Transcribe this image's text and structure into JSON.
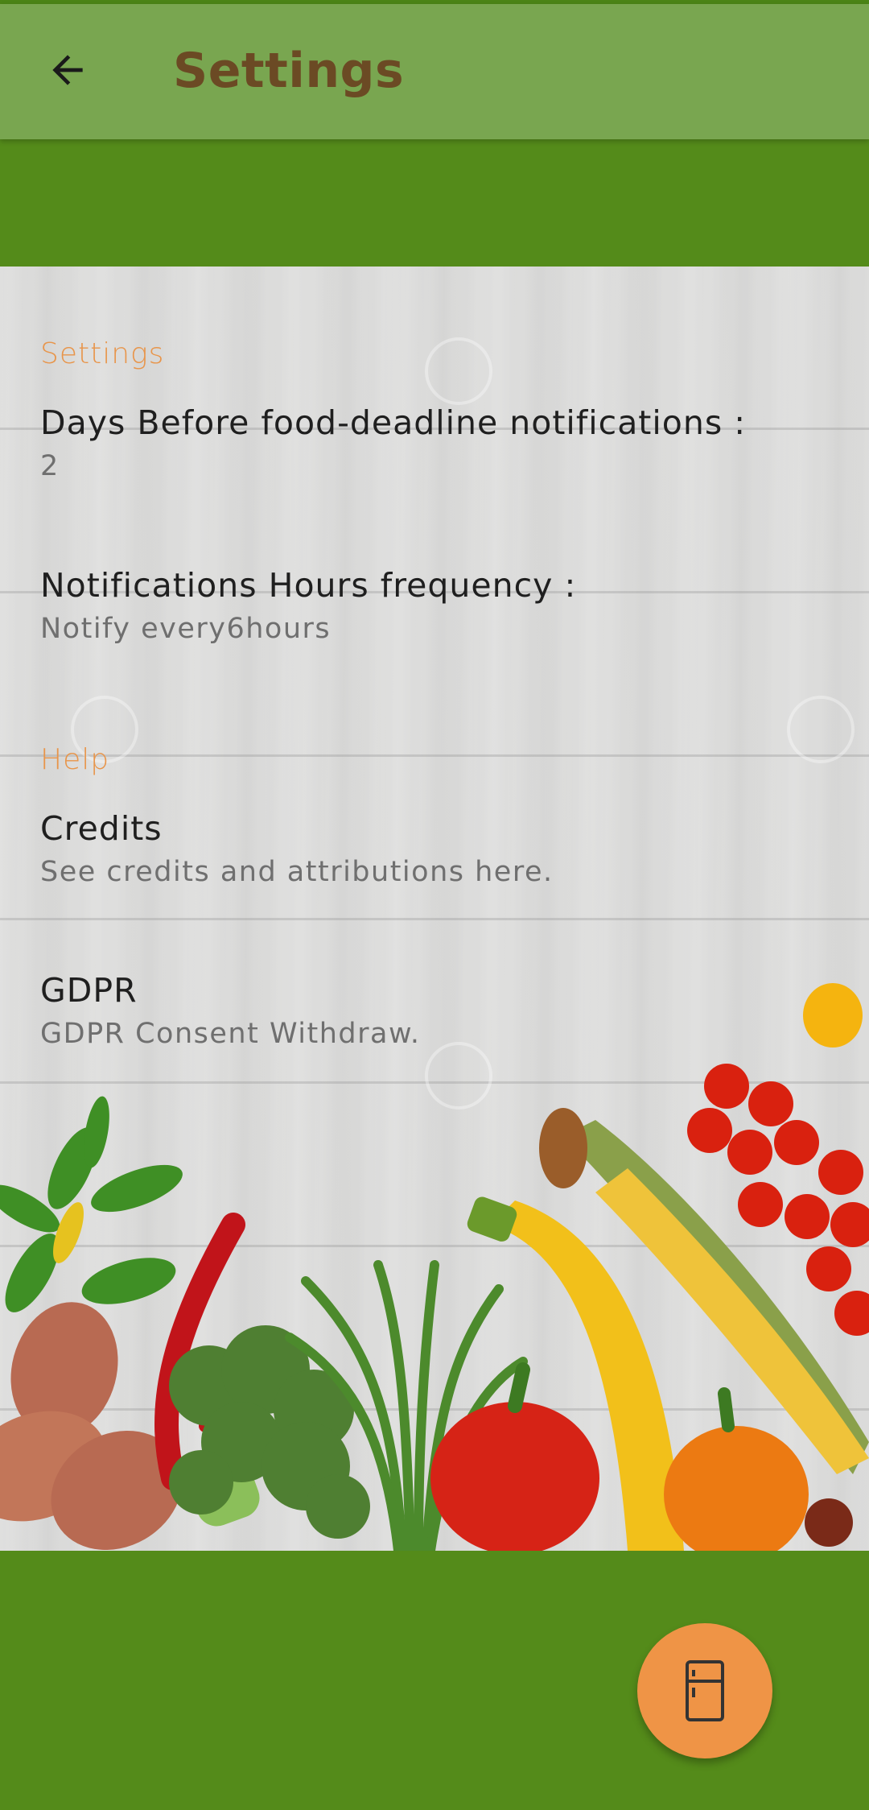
{
  "app_bar": {
    "title": "Settings",
    "back_icon": "arrow-left-icon"
  },
  "sections": [
    {
      "header": "Settings",
      "items": [
        {
          "title": "Days Before food-deadline notifications :",
          "summary": "2"
        },
        {
          "title": "Notifications Hours frequency :",
          "summary": "Notify every6hours"
        }
      ]
    },
    {
      "header": "Help",
      "items": [
        {
          "title": "Credits",
          "summary": "See credits and attributions here."
        },
        {
          "title": "GDPR",
          "summary": "GDPR Consent Withdraw."
        }
      ]
    }
  ],
  "fab": {
    "icon": "fridge-icon"
  },
  "colors": {
    "app_bar": "#79a650",
    "background_green": "#548b1a",
    "title_brown": "#6b4a24",
    "accent_orange": "#ef9446",
    "section_header": "#e8954a"
  }
}
